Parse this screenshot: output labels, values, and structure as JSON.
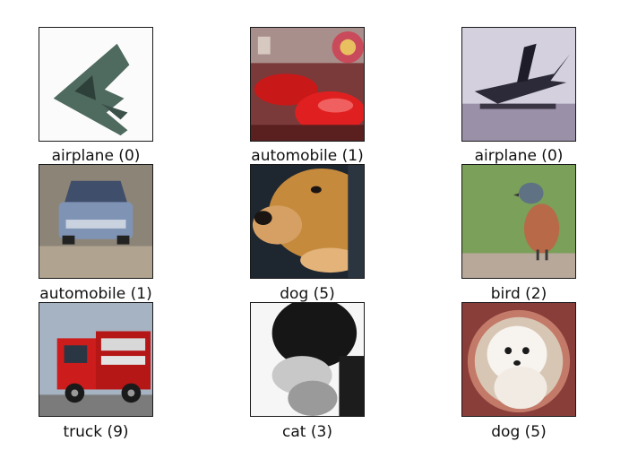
{
  "grid": {
    "cells": [
      {
        "label": "airplane (0)",
        "subject": "stealth bomber airplane"
      },
      {
        "label": "automobile (1)",
        "subject": "red sports car in showroom"
      },
      {
        "label": "airplane (0)",
        "subject": "dark airplane on runway"
      },
      {
        "label": "automobile (1)",
        "subject": "blue sedan"
      },
      {
        "label": "dog (5)",
        "subject": "golden dog close-up"
      },
      {
        "label": "bird (2)",
        "subject": "orange-breasted bird on grass"
      },
      {
        "label": "truck (9)",
        "subject": "red fire truck"
      },
      {
        "label": "cat (3)",
        "subject": "black and white cat"
      },
      {
        "label": "dog (5)",
        "subject": "white fluffy dog"
      }
    ]
  }
}
